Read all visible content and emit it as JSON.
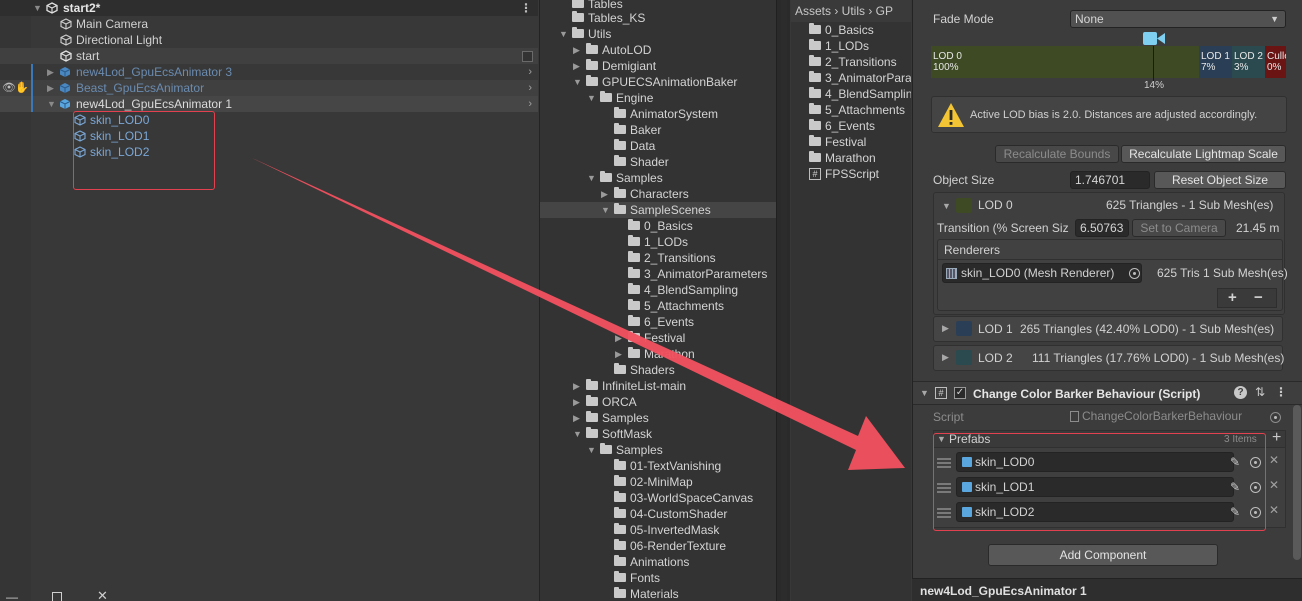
{
  "hierarchy": {
    "scene": "start2*",
    "items": [
      {
        "label": "Main Camera"
      },
      {
        "label": "Directional Light"
      },
      {
        "label": "start"
      },
      {
        "label": "new4Lod_GpuEcsAnimator 3"
      },
      {
        "label": "Beast_GpuEcsAnimator"
      },
      {
        "label": "new4Lod_GpuEcsAnimator 1"
      },
      {
        "label": "skin_LOD0"
      },
      {
        "label": "skin_LOD1"
      },
      {
        "label": "skin_LOD2"
      }
    ]
  },
  "project": {
    "items": [
      {
        "label": "Tables"
      },
      {
        "label": "Tables_KS"
      },
      {
        "label": "Utils"
      },
      {
        "label": "AutoLOD"
      },
      {
        "label": "Demigiant"
      },
      {
        "label": "GPUECSAnimationBaker"
      },
      {
        "label": "Engine"
      },
      {
        "label": "AnimatorSystem"
      },
      {
        "label": "Baker"
      },
      {
        "label": "Data"
      },
      {
        "label": "Shader"
      },
      {
        "label": "Samples"
      },
      {
        "label": "Characters"
      },
      {
        "label": "SampleScenes"
      },
      {
        "label": "0_Basics"
      },
      {
        "label": "1_LODs"
      },
      {
        "label": "2_Transitions"
      },
      {
        "label": "3_AnimatorParameters"
      },
      {
        "label": "4_BlendSampling"
      },
      {
        "label": "5_Attachments"
      },
      {
        "label": "6_Events"
      },
      {
        "label": "Festival"
      },
      {
        "label": "Marathon"
      },
      {
        "label": "Shaders"
      },
      {
        "label": "InfiniteList-main"
      },
      {
        "label": "ORCA"
      },
      {
        "label": "Samples"
      },
      {
        "label": "SoftMask"
      },
      {
        "label": "Samples"
      },
      {
        "label": "01-TextVanishing"
      },
      {
        "label": "02-MiniMap"
      },
      {
        "label": "03-WorldSpaceCanvas"
      },
      {
        "label": "04-CustomShader"
      },
      {
        "label": "05-InvertedMask"
      },
      {
        "label": "06-RenderTexture"
      },
      {
        "label": "Animations"
      },
      {
        "label": "Fonts"
      },
      {
        "label": "Materials"
      }
    ]
  },
  "assets": {
    "breadcrumb": "Assets › Utils › GP",
    "items": [
      {
        "label": "0_Basics"
      },
      {
        "label": "1_LODs"
      },
      {
        "label": "2_Transitions"
      },
      {
        "label": "3_AnimatorPara"
      },
      {
        "label": "4_BlendSamplin"
      },
      {
        "label": "5_Attachments"
      },
      {
        "label": "6_Events"
      },
      {
        "label": "Festival"
      },
      {
        "label": "Marathon"
      },
      {
        "label": "FPSScript"
      }
    ]
  },
  "inspector": {
    "fade_mode_label": "Fade Mode",
    "fade_mode_value": "None",
    "lod_bar": {
      "lod0_name": "LOD 0",
      "lod0_pct": "100%",
      "lod1_name": "LOD 1",
      "lod1_pct": "7%",
      "lod2_name": "LOD 2",
      "lod2_pct": "3%",
      "culled_name": "Culle",
      "culled_pct": "0%",
      "marker": "14%"
    },
    "warning": "Active LOD bias is 2.0. Distances are adjusted accordingly.",
    "recalc_bounds": "Recalculate Bounds",
    "recalc_lightmap": "Recalculate Lightmap Scale",
    "object_size_label": "Object Size",
    "object_size_value": "1.746701",
    "reset_object_size": "Reset Object Size",
    "lod0": {
      "name": "LOD 0",
      "triangles": "625 Triangles  - 1 Sub Mesh(es)",
      "transition_label": "Transition (% Screen Siz",
      "transition_value": "6.50763",
      "set_to_camera": "Set to Camera",
      "distance": "21.45 m",
      "renderers_label": "Renderers",
      "renderer_name": "skin_LOD0 (Mesh Renderer)",
      "renderer_info": "625 Tris 1 Sub Mesh(es)",
      "plus": "+",
      "minus": "−"
    },
    "lod1": {
      "name": "LOD 1",
      "info": "265 Triangles (42.40% LOD0) - 1 Sub Mesh(es)"
    },
    "lod2": {
      "name": "LOD 2",
      "info": "111 Triangles (17.76% LOD0) - 1 Sub Mesh(es)"
    },
    "component": {
      "title": "Change Color Barker Behaviour (Script)",
      "script_label": "Script",
      "script_value": "ChangeColorBarkerBehaviour",
      "prefabs_label": "Prefabs",
      "prefabs_count": "3 Items",
      "prefabs": [
        {
          "name": "skin_LOD0"
        },
        {
          "name": "skin_LOD1"
        },
        {
          "name": "skin_LOD2"
        }
      ]
    },
    "add_component": "Add Component",
    "footer": "new4Lod_GpuEcsAnimator 1"
  },
  "colors": {
    "accent_red": "#f0505e",
    "selection_blue": "#2c5d87",
    "prefab_text": "#7ba7d6",
    "lod0_green": "#3d4a24",
    "lod1_blue": "#2a3f55",
    "lod2_teal": "#2b4a50",
    "culled_red": "#6a1414"
  }
}
